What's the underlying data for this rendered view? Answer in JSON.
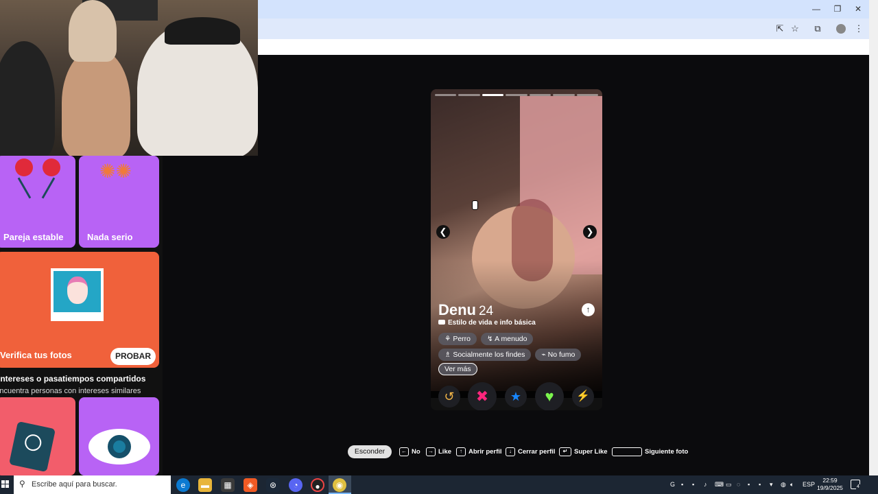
{
  "left_panel": {
    "tiles": [
      {
        "label": "Pareja estable"
      },
      {
        "label": "Nada serio"
      }
    ],
    "verify": {
      "label": "Verifica tus fotos",
      "button": "PROBAR"
    },
    "section": {
      "title": "Intereses o pasatiempos compartidos",
      "subtitle": "Encuentra personas con intereses similares"
    }
  },
  "profile": {
    "name": "Denu",
    "age": "24",
    "lifestyle_label": "Estilo de vida e info básica",
    "photo_count": 7,
    "current_photo": 3,
    "chips_row1": [
      "Perro",
      "A menudo"
    ],
    "chips_row2": [
      "Socialmente los findes",
      "No fumo"
    ],
    "more_label": "Ver más",
    "actions": [
      {
        "name": "rewind",
        "glyph": "↺",
        "color": "#f5b748"
      },
      {
        "name": "nope",
        "glyph": "✖",
        "color": "#fd267d"
      },
      {
        "name": "super-like",
        "glyph": "★",
        "color": "#1786ff"
      },
      {
        "name": "like",
        "glyph": "♥",
        "color": "#7bf54d"
      },
      {
        "name": "boost",
        "glyph": "⚡",
        "color": "#a650f7"
      }
    ]
  },
  "shortcuts": {
    "hide": "Esconder",
    "items": [
      {
        "key": "←",
        "label": "No"
      },
      {
        "key": "→",
        "label": "Like"
      },
      {
        "key": "↑",
        "label": "Abrir perfil"
      },
      {
        "key": "↓",
        "label": "Cerrar perfil"
      },
      {
        "key": "↵",
        "label": "Super Like"
      },
      {
        "key": "",
        "label": "Siguiente foto"
      }
    ]
  },
  "taskbar": {
    "search_placeholder": "Escribe aquí para buscar.",
    "language": "ESP",
    "time": "22:59",
    "date": "19/9/2025",
    "notifications": "4"
  }
}
